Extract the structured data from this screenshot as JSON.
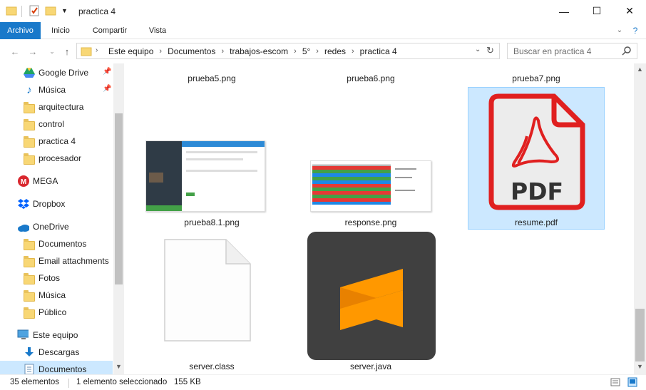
{
  "window": {
    "title": "practica 4",
    "minimize": "—",
    "maximize": "☐",
    "close": "✕"
  },
  "ribbon": {
    "tabs": [
      "Archivo",
      "Inicio",
      "Compartir",
      "Vista"
    ]
  },
  "address": {
    "crumbs": [
      "Este equipo",
      "Documentos",
      "trabajos-escom",
      "5°",
      "redes",
      "practica 4"
    ]
  },
  "search": {
    "placeholder": "Buscar en practica 4"
  },
  "nav": {
    "items": [
      {
        "label": "Google Drive",
        "icon": "google-drive-icon",
        "pinned": true
      },
      {
        "label": "Música",
        "icon": "music-icon",
        "pinned": true
      },
      {
        "label": "arquitectura",
        "icon": "folder-icon"
      },
      {
        "label": "control",
        "icon": "folder-icon"
      },
      {
        "label": "practica 4",
        "icon": "folder-icon"
      },
      {
        "label": "procesador",
        "icon": "folder-icon"
      },
      {
        "label": "MEGA",
        "icon": "mega-icon"
      },
      {
        "label": "Dropbox",
        "icon": "dropbox-icon"
      },
      {
        "label": "OneDrive",
        "icon": "onedrive-icon"
      },
      {
        "label": "Documentos",
        "icon": "folder-icon"
      },
      {
        "label": "Email attachments",
        "icon": "folder-icon"
      },
      {
        "label": "Fotos",
        "icon": "folder-icon"
      },
      {
        "label": "Música",
        "icon": "folder-icon"
      },
      {
        "label": "Público",
        "icon": "folder-icon"
      },
      {
        "label": "Este equipo",
        "icon": "computer-icon"
      },
      {
        "label": "Descargas",
        "icon": "download-icon"
      },
      {
        "label": "Documentos",
        "icon": "documents-icon"
      }
    ]
  },
  "files": [
    {
      "name": "prueba5.png"
    },
    {
      "name": "prueba6.png"
    },
    {
      "name": "prueba7.png"
    },
    {
      "name": "prueba8.1.png"
    },
    {
      "name": "response.png"
    },
    {
      "name": "resume.pdf",
      "selected": true,
      "badge": "PDF"
    },
    {
      "name": "server.class"
    },
    {
      "name": "server.java"
    }
  ],
  "status": {
    "count": "35 elementos",
    "selection": "1 elemento seleccionado",
    "size": "155 KB"
  },
  "colors": {
    "accent": "#1979ca",
    "selection": "#cce8ff",
    "pdf_red": "#e02020",
    "sublime_orange": "#ff9800"
  }
}
